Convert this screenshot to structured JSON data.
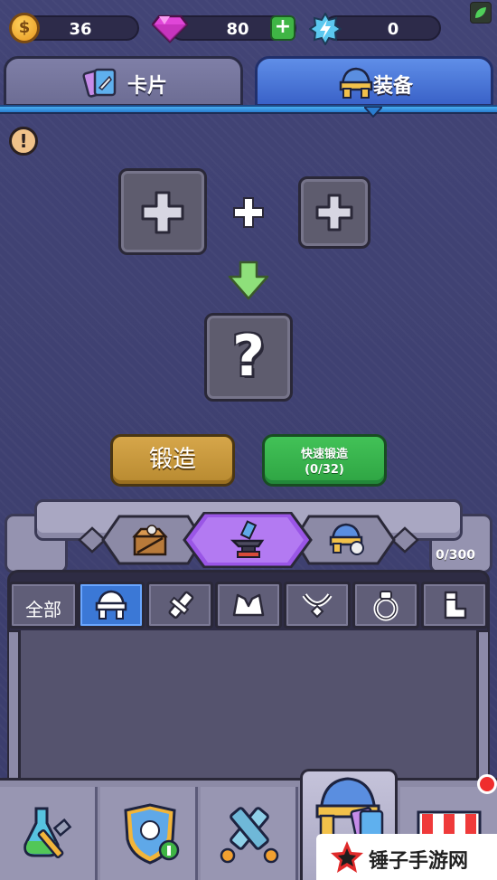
{
  "currency": {
    "coins": "36",
    "coin_symbol": "$",
    "gems": "80",
    "energy": "0",
    "add_symbol": "+"
  },
  "tabs": [
    {
      "label": "卡片",
      "active": false
    },
    {
      "label": "装备",
      "active": true
    }
  ],
  "forge": {
    "warning_symbol": "!",
    "result_symbol": "?",
    "forge_button": "锻造",
    "quick_forge_button": "快速锻造",
    "quick_forge_count": "(0/32)"
  },
  "inventory": {
    "count": "0/300",
    "categories": [
      {
        "label": "全部",
        "icon": "all-text"
      },
      {
        "label": "",
        "icon": "helmet-icon",
        "active": true
      },
      {
        "label": "",
        "icon": "weapon-icon"
      },
      {
        "label": "",
        "icon": "armor-icon"
      },
      {
        "label": "",
        "icon": "necklace-icon"
      },
      {
        "label": "",
        "icon": "ring-icon"
      },
      {
        "label": "",
        "icon": "boots-icon"
      }
    ]
  },
  "nav": {
    "items": [
      "potion-tools-icon",
      "hero-badge-icon",
      "crossed-swords-icon",
      "equipment-icon",
      "shop-icon"
    ]
  },
  "watermark": {
    "text": "锤子手游网"
  },
  "colors": {
    "accent_blue": "#3b78d6",
    "forge_gold": "#c9993e",
    "quick_green": "#35b34b",
    "gem_pink": "#e03fd6"
  }
}
